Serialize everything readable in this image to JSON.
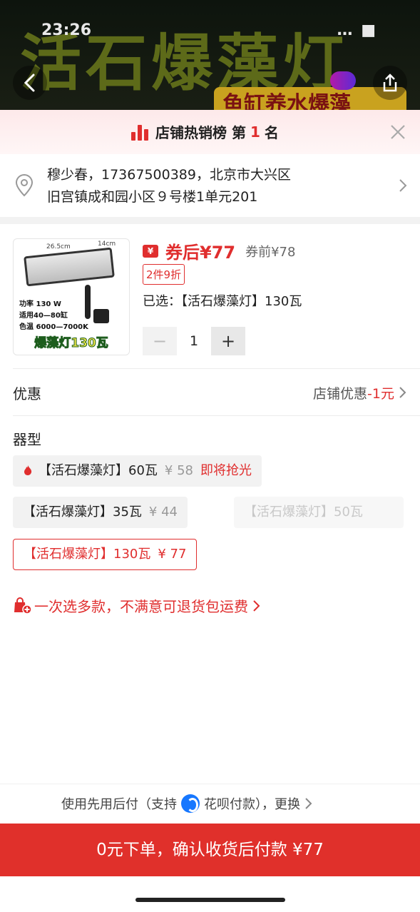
{
  "status_bar": {
    "time": "23:26",
    "right": "… ■"
  },
  "hero": {
    "title": "活石爆藻灯",
    "subtitle": "鱼缸养水爆藻"
  },
  "rank": {
    "prefix": "店铺热销榜 第",
    "number": "1",
    "suffix": "名"
  },
  "address": {
    "line1": "穆少春，17367500389，北京市大兴区",
    "line2": "旧宫镇成和园小区９号楼1单元201"
  },
  "product": {
    "thumb": {
      "dim_w": "26.5cm",
      "dim_d": "14cm",
      "spec1": "功率 130 W",
      "spec2": "适用40—80缸",
      "spec3": "色温 6000—7000K",
      "tag": "爆藻灯130瓦"
    },
    "coupon_icon": "¥",
    "price_after": "券后¥77",
    "price_before": "券前¥78",
    "discount": "2件9折",
    "selected": "已选：【活石爆藻灯】130瓦",
    "quantity": "1",
    "minus": "−",
    "plus": "+"
  },
  "promo": {
    "label": "优惠",
    "prefix": "店铺优惠",
    "amount": "-1元"
  },
  "model": {
    "label": "器型",
    "options": [
      {
        "name": "【活石爆藻灯】60瓦",
        "price": "¥ 58",
        "note": "即将抢光"
      },
      {
        "name": "【活石爆藻灯】35瓦",
        "price": "¥ 44"
      },
      {
        "name": "【活石爆藻灯】50瓦"
      },
      {
        "name": "【活石爆藻灯】130瓦",
        "price": "¥ 77"
      }
    ]
  },
  "bundle": {
    "text": "一次选多款，不满意可退货包运费"
  },
  "paylater": {
    "prefix": "使用先用后付（支持",
    "brand": "花呗付款",
    "suffix": "），更换"
  },
  "cta": {
    "label": "0元下单，确认收货后付款 ¥77"
  },
  "colors": {
    "accent": "#e0302b",
    "hero_bg": "#0d140d"
  }
}
